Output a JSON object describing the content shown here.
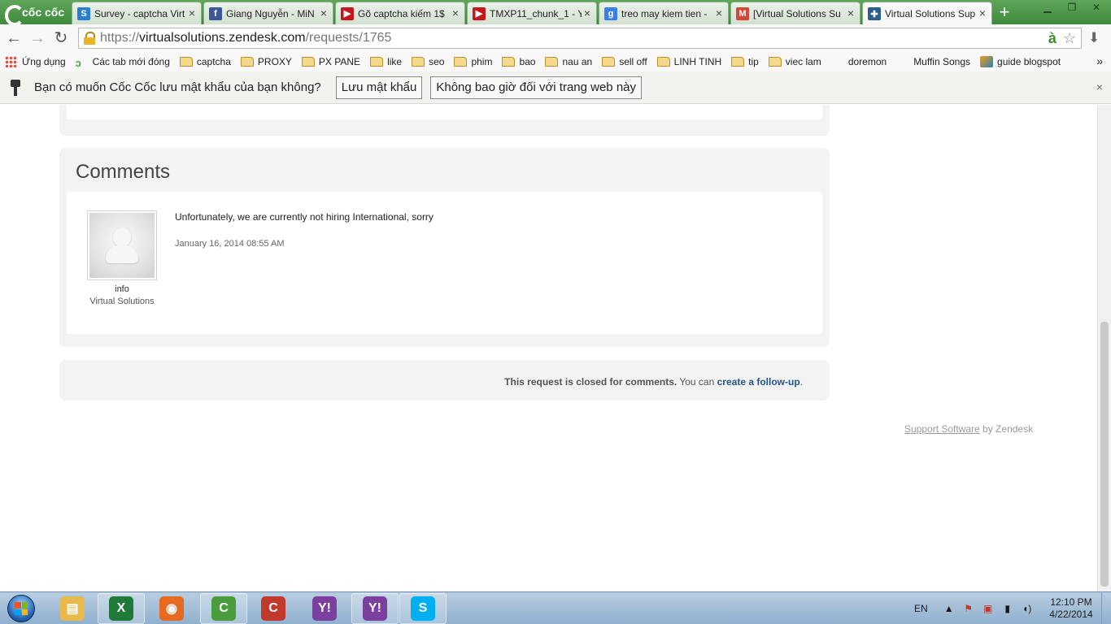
{
  "browser": {
    "brand": "cốc cốc",
    "tabs": [
      {
        "title": "Survey - captcha Virt",
        "icon": "survey-icon",
        "color": "#2a7fd4",
        "glyph": "S"
      },
      {
        "title": "Giang Nguyễn - MiN",
        "icon": "facebook-icon",
        "color": "#3b5998",
        "glyph": "f"
      },
      {
        "title": "Gõ captcha kiếm 1$",
        "icon": "youtube-icon",
        "color": "#c4161c",
        "glyph": "▶"
      },
      {
        "title": "TMXP11_chunk_1 - Y",
        "icon": "youtube-icon",
        "color": "#c4161c",
        "glyph": "▶"
      },
      {
        "title": "treo may kiem tien -",
        "icon": "google-icon",
        "color": "#3b7ded",
        "glyph": "g"
      },
      {
        "title": "[Virtual Solutions Su",
        "icon": "gmail-icon",
        "color": "#d44638",
        "glyph": "M"
      },
      {
        "title": "Virtual Solutions Sup",
        "icon": "zendesk-icon",
        "color": "#2b5e8f",
        "glyph": "✚"
      }
    ],
    "new_tab": "+",
    "window": {
      "minimize": "▁",
      "maximize": "❐",
      "close": "✕"
    },
    "nav": {
      "back": "←",
      "forward": "→",
      "reload": "↻"
    },
    "url": {
      "scheme": "https://",
      "host": "virtualsolutions.zendesk.com",
      "path": "/requests/1765"
    },
    "omni": {
      "translate": "à",
      "star": "☆"
    },
    "download": "⬇",
    "bookmarks": [
      {
        "label": "Ứng dụng",
        "icon": "apps-icon"
      },
      {
        "label": "Các tab mới đóng",
        "icon": "leaf-icon"
      },
      {
        "label": "captcha",
        "icon": "folder-icon"
      },
      {
        "label": "PROXY",
        "icon": "folder-icon"
      },
      {
        "label": "PX PANE",
        "icon": "folder-icon"
      },
      {
        "label": "like",
        "icon": "folder-icon"
      },
      {
        "label": "seo",
        "icon": "folder-icon"
      },
      {
        "label": "phim",
        "icon": "folder-icon"
      },
      {
        "label": "bao",
        "icon": "folder-icon"
      },
      {
        "label": "nau an",
        "icon": "folder-icon"
      },
      {
        "label": "sell off",
        "icon": "folder-icon"
      },
      {
        "label": "LINH TINH",
        "icon": "folder-icon"
      },
      {
        "label": "tip",
        "icon": "folder-icon"
      },
      {
        "label": "viec lam",
        "icon": "folder-icon"
      },
      {
        "label": "doremon",
        "icon": "youtube-icon"
      },
      {
        "label": "Muffin Songs",
        "icon": "youtube-icon"
      },
      {
        "label": "guide blogspot",
        "icon": "blog-icon"
      }
    ],
    "bookmarks_more": "»"
  },
  "infobar": {
    "message": "Bạn có muốn Cốc Cốc lưu mật khẩu của bạn không?",
    "save_label": "Lưu mật khẩu",
    "never_label": "Không bao giờ đối với trang web này",
    "close": "×"
  },
  "page": {
    "comments_title": "Comments",
    "comment": {
      "author": "info",
      "organization": "Virtual Solutions",
      "body": "Unfortunately, we are currently not hiring International, sorry",
      "date": "January 16, 2014 08:55 AM"
    },
    "closed": {
      "strong": "This request is closed for comments.",
      "text": " You can ",
      "link": "create a follow-up",
      "end": "."
    },
    "footer": {
      "link": "Support Software",
      "text": " by Zendesk"
    }
  },
  "taskbar": {
    "apps": [
      {
        "name": "file-explorer-icon",
        "color": "#e8b84a",
        "glyph": "▤"
      },
      {
        "name": "excel-icon",
        "color": "#1f7a3a",
        "glyph": "X"
      },
      {
        "name": "firefox-icon",
        "color": "#e66a1f",
        "glyph": "◉"
      },
      {
        "name": "coccoc-icon",
        "color": "#4a9d3c",
        "glyph": "C"
      },
      {
        "name": "ccleaner-icon",
        "color": "#c0392b",
        "glyph": "C"
      },
      {
        "name": "yahoo-messenger-icon",
        "color": "#7b3fa0",
        "glyph": "Y!"
      },
      {
        "name": "yahoo-messenger-2-icon",
        "color": "#7b3fa0",
        "glyph": "Y!"
      },
      {
        "name": "skype-icon",
        "color": "#00aff0",
        "glyph": "S"
      }
    ],
    "lang": "EN",
    "tray_up": "▲",
    "time": "12:10 PM",
    "date": "4/22/2014"
  }
}
